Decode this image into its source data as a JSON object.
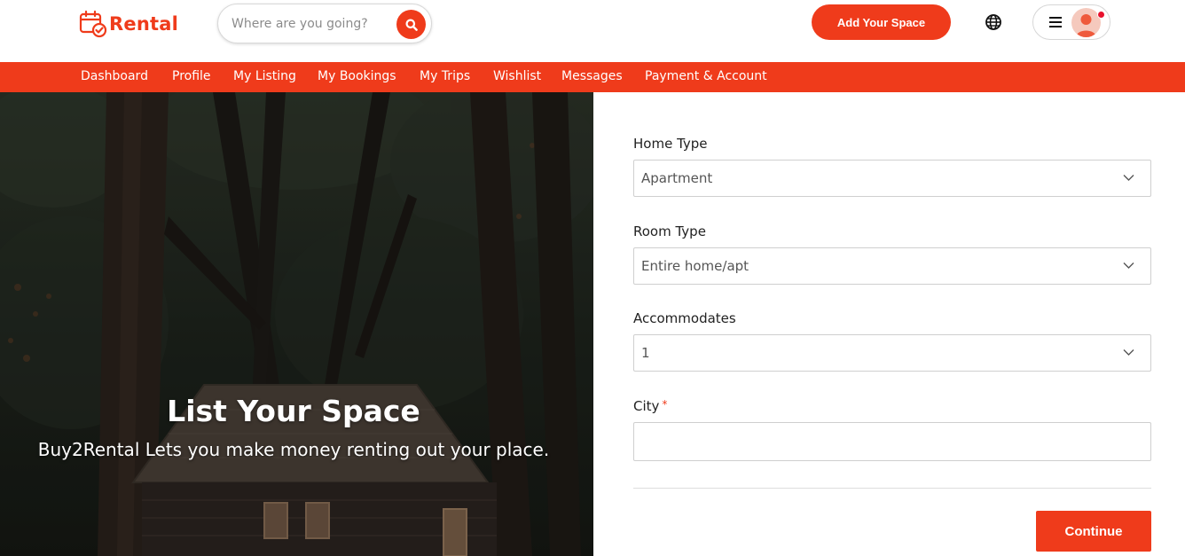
{
  "brand": {
    "name": "Rental",
    "accent": "#ef3b1b"
  },
  "header": {
    "search_placeholder": "Where are you going?",
    "add_space_label": "Add Your Space"
  },
  "nav": {
    "items": [
      {
        "label": "Dashboard"
      },
      {
        "label": "Profile"
      },
      {
        "label": "My Listing"
      },
      {
        "label": "My Bookings"
      },
      {
        "label": "My Trips"
      },
      {
        "label": "Wishlist"
      },
      {
        "label": "Messages"
      },
      {
        "label": "Payment & Account"
      }
    ]
  },
  "hero": {
    "title": "List Your Space",
    "subtitle": "Buy2Rental Lets you make money renting out your place."
  },
  "form": {
    "home_type": {
      "label": "Home Type",
      "value": "Apartment"
    },
    "room_type": {
      "label": "Room Type",
      "value": "Entire home/apt"
    },
    "accommodates": {
      "label": "Accommodates",
      "value": "1"
    },
    "city": {
      "label": "City",
      "required_mark": "*",
      "value": ""
    },
    "continue_label": "Continue"
  },
  "icons": {
    "logo": "calendar-check-icon",
    "search": "search-icon",
    "language": "globe-icon",
    "menu": "hamburger-icon",
    "avatar": "user-avatar-icon",
    "select": "chevron-down-icon"
  }
}
